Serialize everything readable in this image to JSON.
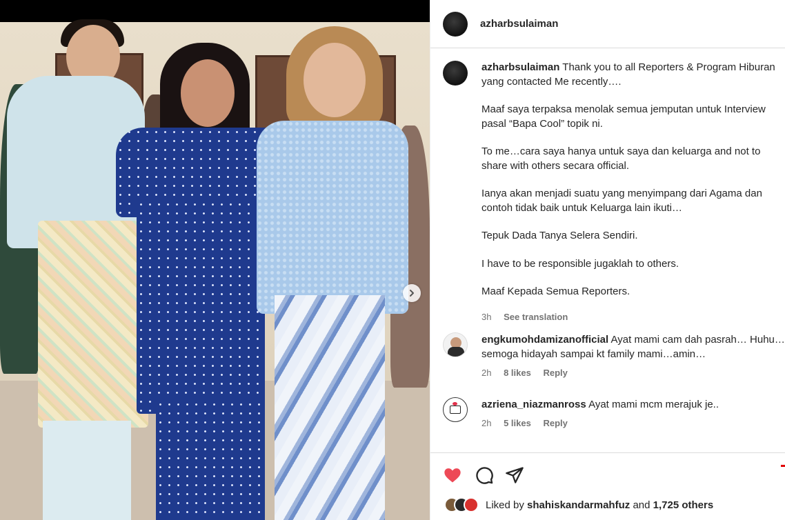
{
  "post": {
    "author": "azharbsulaiman",
    "caption": {
      "username": "azharbsulaiman",
      "first_line": "Thank you to all Reporters & Program Hiburan yang contacted Me recently….",
      "paragraphs": [
        "Maaf saya terpaksa menolak semua jemputan untuk Interview pasal “Bapa Cool” topik ni.",
        "To me…cara saya hanya untuk saya dan keluarga and not to share with others secara official.",
        "Ianya akan menjadi suatu yang menyimpang dari Agama dan contoh tidak baik untuk Keluarga lain ikuti…",
        "Tepuk Dada Tanya Selera Sendiri.",
        "I have to be responsible jugaklah to others.",
        "Maaf Kepada Semua Reporters."
      ],
      "time": "3h",
      "see_translation": "See translation"
    },
    "comments": [
      {
        "username": "engkumohdamizanofficial",
        "text": "Ayat mami cam dah pasrah… Huhu…semoga hidayah sampai kt family mami…amin…",
        "time": "2h",
        "likes": "8 likes",
        "reply": "Reply"
      },
      {
        "username": "azriena_niazmanross",
        "text": "Ayat mami mcm merajuk je..",
        "time": "2h",
        "likes": "5 likes",
        "reply": "Reply"
      }
    ],
    "liked_by": {
      "prefix": "Liked by",
      "user": "shahiskandarmahfuz",
      "middle": "and",
      "count": "1,725 others"
    },
    "icons": [
      "heart-icon",
      "comment-icon",
      "share-icon",
      "chevron-right-icon"
    ],
    "colors": {
      "heart": "#ed4956",
      "text": "#262626",
      "secondary": "#737373",
      "border": "#dbdbdb"
    }
  }
}
